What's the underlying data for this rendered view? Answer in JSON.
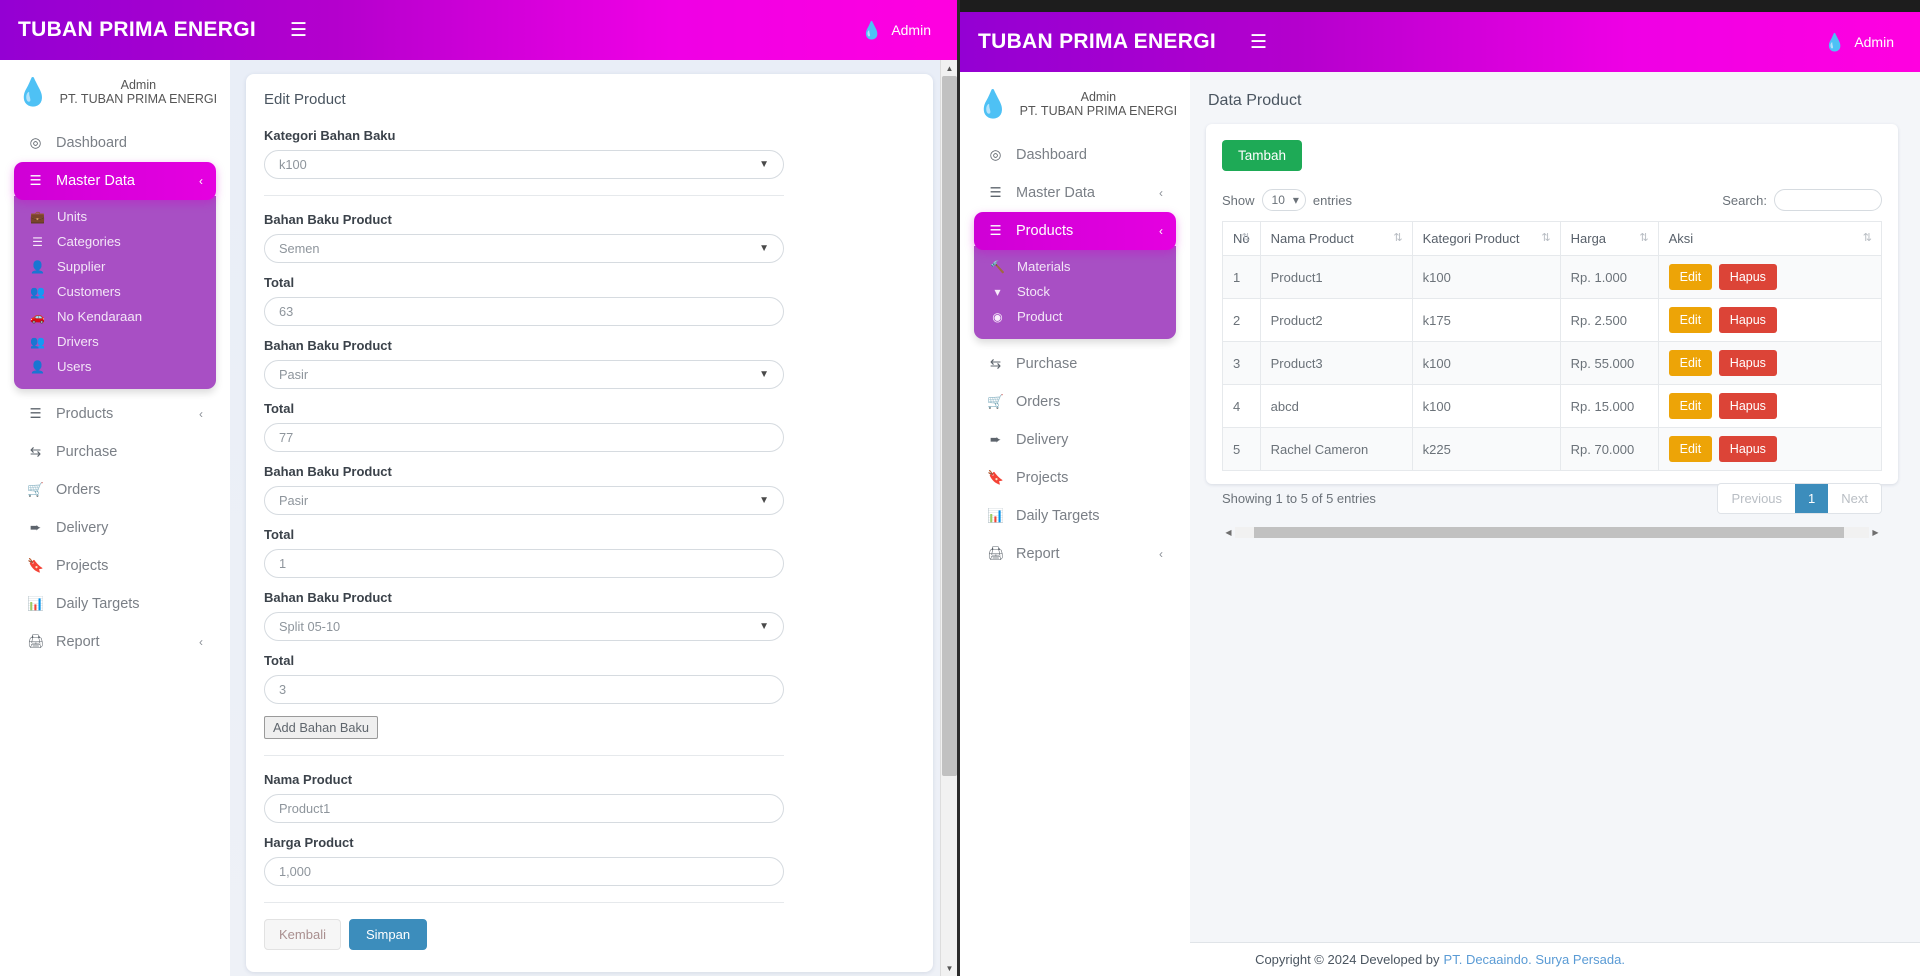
{
  "app": {
    "brand": "TUBAN PRIMA ENERGI",
    "hamburger_icon": "hamburger-menu-icon",
    "nav_user": "Admin",
    "drop_icon": "water-drop-icon"
  },
  "sidebar": {
    "user_name": "Admin",
    "user_company": "PT. TUBAN PRIMA ENERGI",
    "items": [
      {
        "label": "Dashboard",
        "icon": "dashboard-icon",
        "caret": ""
      },
      {
        "label": "Master Data",
        "icon": "server-icon",
        "caret": "‹"
      },
      {
        "label": "Products",
        "icon": "server-icon",
        "caret": "‹"
      },
      {
        "label": "Purchase",
        "icon": "exchange-icon",
        "caret": ""
      },
      {
        "label": "Orders",
        "icon": "shopping-cart-icon",
        "caret": ""
      },
      {
        "label": "Delivery",
        "icon": "paper-plane-icon",
        "caret": ""
      },
      {
        "label": "Projects",
        "icon": "bookmark-icon",
        "caret": ""
      },
      {
        "label": "Daily Targets",
        "icon": "bar-chart-icon",
        "caret": ""
      },
      {
        "label": "Report",
        "icon": "printer-icon",
        "caret": "‹"
      }
    ],
    "master_data_sub": [
      {
        "label": "Units",
        "icon": "briefcase-icon"
      },
      {
        "label": "Categories",
        "icon": "list-icon"
      },
      {
        "label": "Supplier",
        "icon": "user-icon"
      },
      {
        "label": "Customers",
        "icon": "users-icon"
      },
      {
        "label": "No Kendaraan",
        "icon": "car-icon"
      },
      {
        "label": "Drivers",
        "icon": "users-icon"
      },
      {
        "label": "Users",
        "icon": "user-icon"
      }
    ],
    "products_sub": [
      {
        "label": "Materials",
        "icon": "hammer-icon"
      },
      {
        "label": "Stock",
        "icon": "filter-icon"
      },
      {
        "label": "Product",
        "icon": "product-icon"
      }
    ]
  },
  "left_window": {
    "active_item": "Master Data",
    "form": {
      "title": "Edit Product",
      "kategori_label": "Kategori Bahan Baku",
      "kategori_value": "k100",
      "rows": [
        {
          "material_label": "Bahan Baku Product",
          "material_value": "Semen",
          "total_label": "Total",
          "total_value": "63"
        },
        {
          "material_label": "Bahan Baku Product",
          "material_value": "Pasir",
          "total_label": "Total",
          "total_value": "77"
        },
        {
          "material_label": "Bahan Baku Product",
          "material_value": "Pasir",
          "total_label": "Total",
          "total_value": "1"
        },
        {
          "material_label": "Bahan Baku Product",
          "material_value": "Split 05-10",
          "total_label": "Total",
          "total_value": "3"
        }
      ],
      "add_button": "Add Bahan Baku",
      "nama_label": "Nama Product",
      "nama_value": "Product1",
      "harga_label": "Harga Product",
      "harga_value": "1,000",
      "back_button": "Kembali",
      "save_button": "Simpan"
    }
  },
  "right_window": {
    "active_item": "Products",
    "page_title": "Data Product",
    "add_button": "Tambah",
    "show_label": "Show",
    "entries_label": "entries",
    "entries_value": "10",
    "search_label": "Search:",
    "search_value": "",
    "table": {
      "columns": [
        "No",
        "Nama Product",
        "Kategori Product",
        "Harga",
        "Aksi"
      ],
      "rows": [
        {
          "no": "1",
          "nama": "Product1",
          "kategori": "k100",
          "harga": "Rp. 1.000",
          "edit": "Edit",
          "hapus": "Hapus"
        },
        {
          "no": "2",
          "nama": "Product2",
          "kategori": "k175",
          "harga": "Rp. 2.500",
          "edit": "Edit",
          "hapus": "Hapus"
        },
        {
          "no": "3",
          "nama": "Product3",
          "kategori": "k100",
          "harga": "Rp. 55.000",
          "edit": "Edit",
          "hapus": "Hapus"
        },
        {
          "no": "4",
          "nama": "abcd",
          "kategori": "k100",
          "harga": "Rp. 15.000",
          "edit": "Edit",
          "hapus": "Hapus"
        },
        {
          "no": "5",
          "nama": "Rachel Cameron",
          "kategori": "k225",
          "harga": "Rp. 70.000",
          "edit": "Edit",
          "hapus": "Hapus"
        }
      ]
    },
    "showing_info": "Showing 1 to 5 of 5 entries",
    "pager": {
      "previous": "Previous",
      "current": "1",
      "next": "Next"
    },
    "footer": {
      "text": "Copyright © 2024 Developed by",
      "link": "PT. Decaaindo. Surya Persada."
    }
  },
  "colors": {
    "brand_start": "#9400d3",
    "brand_end": "#ff00e0",
    "active_menu": "#e500e0",
    "submenu": "#a84fc4",
    "success": "#1eaa56",
    "edit": "#eda407",
    "danger": "#dc4437",
    "primary": "#3c8dbc"
  }
}
